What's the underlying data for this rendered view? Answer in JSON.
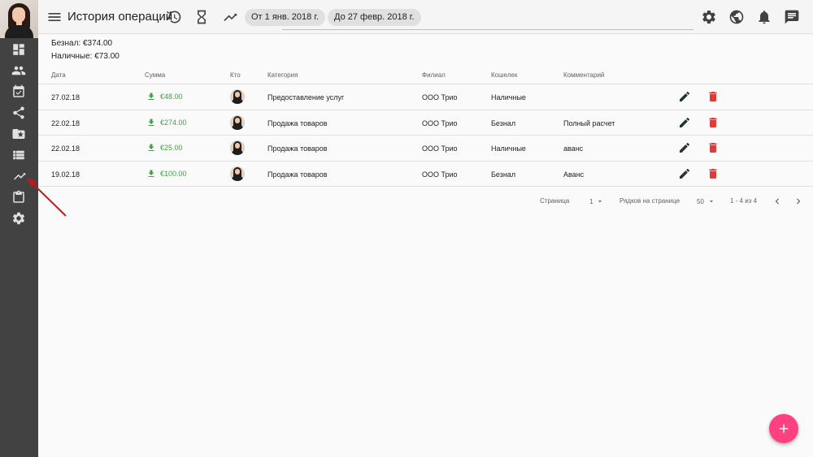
{
  "header": {
    "title": "История операций",
    "date_from": "От 1 янв. 2018 г.",
    "date_to": "До 27 февр. 2018 г."
  },
  "summary": {
    "non_cash": "Безнал: €374.00",
    "cash": "Наличные: €73.00"
  },
  "table": {
    "columns": [
      "Дата",
      "Сумма",
      "Кто",
      "Категория",
      "Филиал",
      "Кошелек",
      "Комментарий"
    ],
    "rows": [
      {
        "date": "27.02.18",
        "amount": "€48.00",
        "category": "Предоставление услуг",
        "branch": "ООО Трио",
        "wallet": "Наличные",
        "comment": ""
      },
      {
        "date": "22.02.18",
        "amount": "€274.00",
        "category": "Продажа товаров",
        "branch": "ООО Трио",
        "wallet": "Безнал",
        "comment": "Полный расчет"
      },
      {
        "date": "22.02.18",
        "amount": "€25.00",
        "category": "Продажа товаров",
        "branch": "ООО Трио",
        "wallet": "Наличные",
        "comment": "аванс"
      },
      {
        "date": "19.02.18",
        "amount": "€100.00",
        "category": "Продажа товаров",
        "branch": "ООО Трио",
        "wallet": "Безнал",
        "comment": "Аванс"
      }
    ]
  },
  "pagination": {
    "page_label": "Страница",
    "page_value": "1",
    "rows_label": "Рядков на странице",
    "rows_value": "50",
    "range": "1 - 4 из 4"
  },
  "icons": {
    "sidebar": [
      "dashboard-icon",
      "people-icon",
      "event-available-icon",
      "share-icon",
      "folder-special-icon",
      "view-list-icon",
      "trending-icon",
      "clipboard-icon",
      "settings-icon"
    ],
    "header": [
      "menu-icon",
      "history-icon",
      "hourglass-icon",
      "trending-icon",
      "settings-icon",
      "globe-icon",
      "bell-icon",
      "chat-icon"
    ]
  },
  "colors": {
    "sidebar_bg": "#424242",
    "income_green": "#43a047",
    "delete_red": "#e53935",
    "fab_pink": "#ff4081",
    "annotation_red": "#b71c1c"
  }
}
